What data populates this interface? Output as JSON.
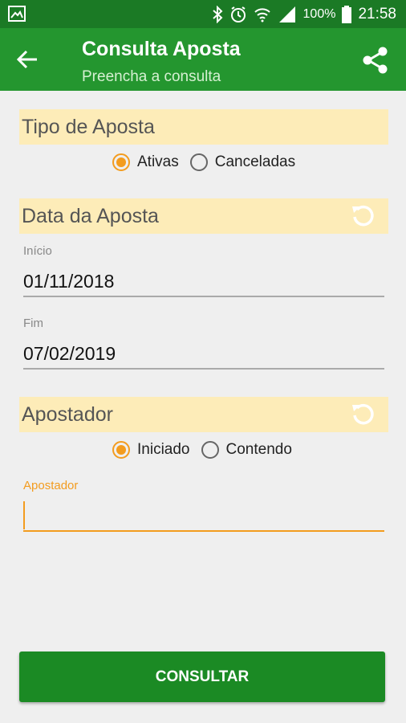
{
  "status_bar": {
    "icons": [
      "gallery-icon",
      "bluetooth-icon",
      "alarm-icon",
      "wifi-icon",
      "signal-icon",
      "battery-icon"
    ],
    "battery_percent": "100%",
    "time": "21:58"
  },
  "app_bar": {
    "title": "Consulta Aposta",
    "subtitle": "Preencha a consulta",
    "icons": [
      "back-arrow-icon",
      "share-icon"
    ]
  },
  "tipo_aposta": {
    "header": "Tipo de Aposta",
    "options": [
      {
        "label": "Ativas",
        "selected": true
      },
      {
        "label": "Canceladas",
        "selected": false
      }
    ]
  },
  "data_aposta": {
    "header": "Data da Aposta",
    "reset_icon": "reset-icon",
    "inicio_label": "Início",
    "inicio_value": "01/11/2018",
    "fim_label": "Fim",
    "fim_value": "07/02/2019"
  },
  "apostador": {
    "header": "Apostador",
    "reset_icon": "reset-icon",
    "options": [
      {
        "label": "Iniciado",
        "selected": true
      },
      {
        "label": "Contendo",
        "selected": false
      }
    ],
    "field_label": "Apostador",
    "field_value": ""
  },
  "actions": {
    "consultar_label": "CONSULTAR"
  },
  "colors": {
    "status_bar": "#1b7a25",
    "app_bar": "#24962f",
    "section_bg": "#fdecb8",
    "accent": "#f39c1f",
    "button": "#1b8a24",
    "background": "#efefef"
  }
}
